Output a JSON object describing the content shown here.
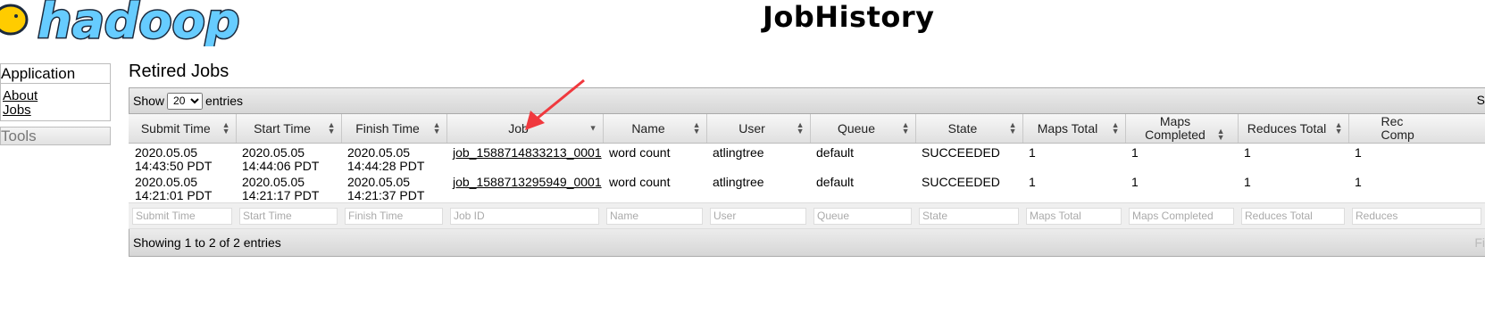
{
  "header": {
    "logo_text": "hadoop",
    "title": "JobHistory"
  },
  "sidebar": {
    "application_header": "Application",
    "links": [
      "About",
      "Jobs"
    ],
    "tools_header": "Tools"
  },
  "main": {
    "section_title": "Retired Jobs",
    "show_label": "Show",
    "entries_value": "20",
    "entries_label": "entries",
    "toolbar_right_clip": "S",
    "columns": [
      "Submit Time",
      "Start Time",
      "Finish Time",
      "Job ID",
      "Name",
      "User",
      "Queue",
      "State",
      "Maps Total",
      "Maps Completed",
      "Reduces Total",
      "Reduces Completed"
    ],
    "header_labels": [
      "Submit Time",
      "Start Time",
      "Finish Time",
      "Job",
      "Name",
      "User",
      "Queue",
      "State",
      "Maps Total",
      "Maps Completed",
      "Reduces Total",
      "Rec\nComp"
    ],
    "rows": [
      [
        "2020.05.05\n14:43:50 PDT",
        "2020.05.05\n14:44:06 PDT",
        "2020.05.05\n14:44:28 PDT",
        "job_1588714833213_0001",
        "word count",
        "atlingtree",
        "default",
        "SUCCEEDED",
        "1",
        "1",
        "1",
        "1"
      ],
      [
        "2020.05.05\n14:21:01 PDT",
        "2020.05.05\n14:21:17 PDT",
        "2020.05.05\n14:21:37 PDT",
        "job_1588713295949_0001",
        "word count",
        "atlingtree",
        "default",
        "SUCCEEDED",
        "1",
        "1",
        "1",
        "1"
      ]
    ],
    "filter_placeholders": [
      "Submit Time",
      "Start Time",
      "Finish Time",
      "Job ID",
      "Name",
      "User",
      "Queue",
      "State",
      "Maps Total",
      "Maps Completed",
      "Reduces Total",
      "Reduces"
    ],
    "footer_text": "Showing 1 to 2 of 2 entries",
    "footer_right_clip": "Fi"
  },
  "colors": {
    "logo_fill": "#66ccff",
    "logo_outline": "#1c2a3d",
    "elephant": "#ffcc00",
    "annotation_arrow": "#f0393e"
  }
}
